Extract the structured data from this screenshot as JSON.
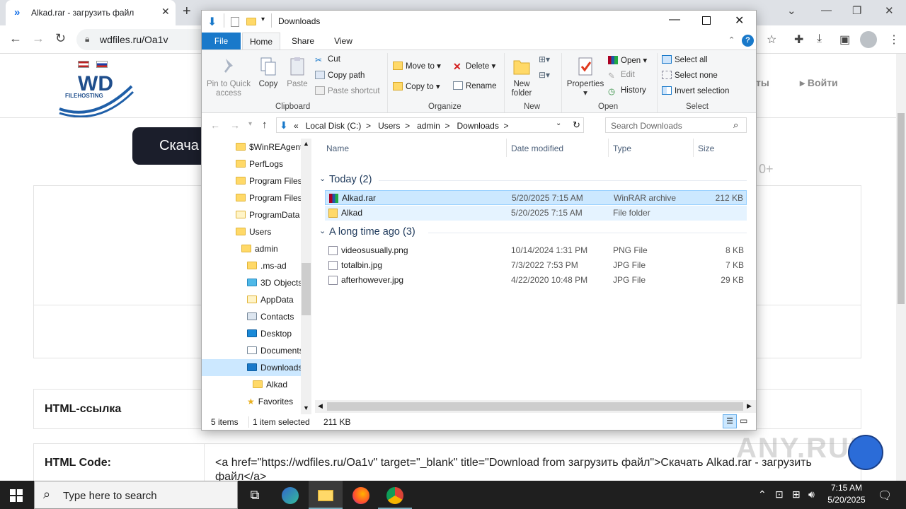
{
  "browser": {
    "tab_title": "Alkad.rar - загрузить файл",
    "url": "wdfiles.ru/Oa1v"
  },
  "site": {
    "logo_text": "WD",
    "logo_sub": "FILEHOSTING",
    "nav_partial": "ты",
    "nav_login": "Войти",
    "download_btn_partial": "Скача",
    "plus_partial": "0+",
    "html_link_label": "HTML-ссылка",
    "html_code_label": "HTML Code:",
    "html_code_value": "<a href=\"https://wdfiles.ru/Oa1v\" target=\"_blank\" title=\"Download from загрузить файл\">Скачать Alkad.rar - загрузить файл</a>",
    "watermark": "ANY.RUN"
  },
  "explorer": {
    "title": "Downloads",
    "tabs": {
      "file": "File",
      "home": "Home",
      "share": "Share",
      "view": "View"
    },
    "ribbon": {
      "pin": "Pin to Quick access",
      "copy": "Copy",
      "paste": "Paste",
      "cut": "Cut",
      "copy_path": "Copy path",
      "paste_shortcut": "Paste shortcut",
      "clipboard": "Clipboard",
      "move_to": "Move to",
      "copy_to": "Copy to",
      "delete": "Delete",
      "rename": "Rename",
      "organize": "Organize",
      "new_folder": "New folder",
      "new": "New",
      "properties": "Properties",
      "open": "Open",
      "edit": "Edit",
      "history": "History",
      "open_group": "Open",
      "select_all": "Select all",
      "select_none": "Select none",
      "invert_selection": "Invert selection",
      "select_group": "Select"
    },
    "address": {
      "prefix": "«",
      "crumbs": [
        "Local Disk (C:)",
        "Users",
        "admin",
        "Downloads"
      ]
    },
    "search_placeholder": "Search Downloads",
    "tree": [
      {
        "label": "$WinREAgent"
      },
      {
        "label": "PerfLogs"
      },
      {
        "label": "Program Files"
      },
      {
        "label": "Program Files"
      },
      {
        "label": "ProgramData"
      },
      {
        "label": "Users"
      },
      {
        "label": "admin"
      },
      {
        "label": ".ms-ad"
      },
      {
        "label": "3D Objects"
      },
      {
        "label": "AppData"
      },
      {
        "label": "Contacts"
      },
      {
        "label": "Desktop"
      },
      {
        "label": "Documents"
      },
      {
        "label": "Downloads"
      },
      {
        "label": "Alkad"
      },
      {
        "label": "Favorites"
      }
    ],
    "columns": {
      "name": "Name",
      "date": "Date modified",
      "type": "Type",
      "size": "Size"
    },
    "groups": [
      {
        "label": "Today (2)",
        "files": [
          {
            "name": "Alkad.rar",
            "date": "5/20/2025 7:15 AM",
            "type": "WinRAR archive",
            "size": "212 KB"
          },
          {
            "name": "Alkad",
            "date": "5/20/2025 7:15 AM",
            "type": "File folder",
            "size": ""
          }
        ]
      },
      {
        "label": "A long time ago (3)",
        "files": [
          {
            "name": "videosusually.png",
            "date": "10/14/2024 1:31 PM",
            "type": "PNG File",
            "size": "8 KB"
          },
          {
            "name": "totalbin.jpg",
            "date": "7/3/2022 7:53 PM",
            "type": "JPG File",
            "size": "7 KB"
          },
          {
            "name": "afterhowever.jpg",
            "date": "4/22/2020 10:48 PM",
            "type": "JPG File",
            "size": "29 KB"
          }
        ]
      }
    ],
    "status": {
      "items": "5 items",
      "selected": "1 item selected",
      "size": "211 KB"
    }
  },
  "taskbar": {
    "search_placeholder": "Type here to search",
    "time": "7:15 AM",
    "date": "5/20/2025"
  }
}
